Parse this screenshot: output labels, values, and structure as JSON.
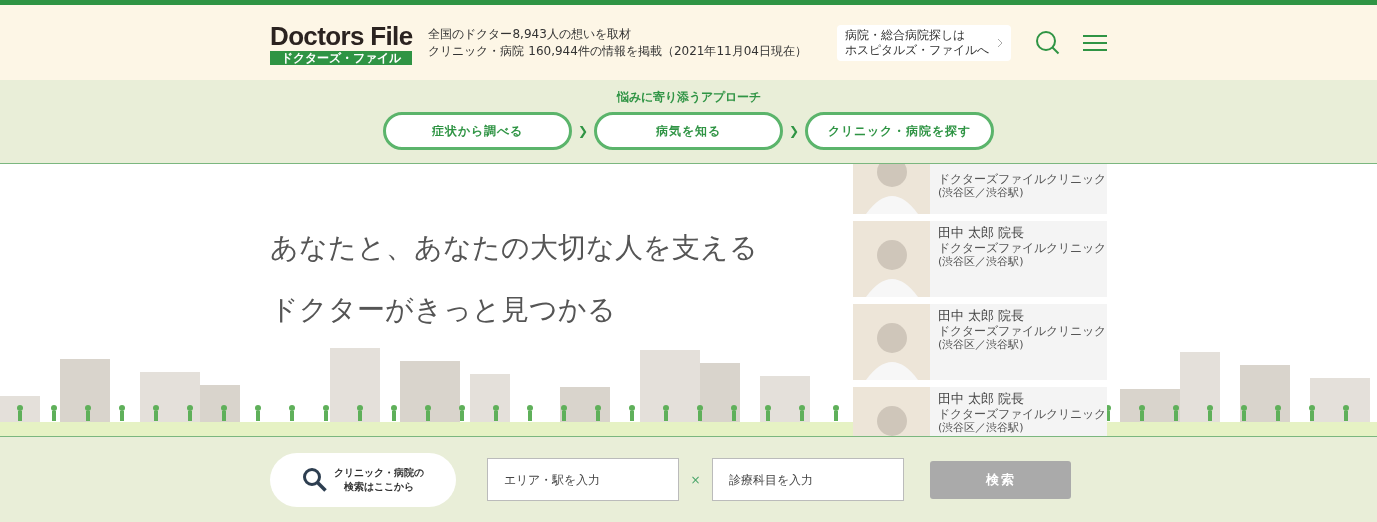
{
  "header": {
    "logo": "Doctors File",
    "logo_sub": "ドクターズ・ファイル",
    "stats": [
      "全国のドクター8,943人の想いを取材",
      "クリニック・病院 160,944件の情報を掲載（2021年11月04日現在）"
    ],
    "hospitals_link": [
      "病院・総合病院探しは",
      "ホスピタルズ・ファイルへ"
    ]
  },
  "approach": {
    "title": "悩みに寄り添うアプローチ",
    "steps": [
      "症状から調べる",
      "病気を知る",
      "クリニック・病院を探す"
    ],
    "separator": "❯"
  },
  "hero": {
    "lines": [
      "あなたと、あなたの大切な人を支える",
      "ドクターがきっと見つかる"
    ]
  },
  "doctors": [
    {
      "clinic": "ドクターズファイルクリニック",
      "location": "(渋谷区／渋谷駅)"
    },
    {
      "name": "田中 太郎 院長",
      "clinic": "ドクターズファイルクリニック",
      "location": "(渋谷区／渋谷駅)"
    },
    {
      "name": "田中 太郎 院長",
      "clinic": "ドクターズファイルクリニック",
      "location": "(渋谷区／渋谷駅)"
    },
    {
      "name": "田中 太郎 院長",
      "clinic": "ドクターズファイルクリニック",
      "location": "(渋谷区／渋谷駅)"
    }
  ],
  "search": {
    "bubble": [
      "クリニック・病院の",
      "検索はここから"
    ],
    "area": {
      "placeholder": "エリア・駅を入力"
    },
    "cross": "×",
    "department": {
      "placeholder": "診療科目を入力"
    },
    "button": "検索",
    "disabled": true
  }
}
